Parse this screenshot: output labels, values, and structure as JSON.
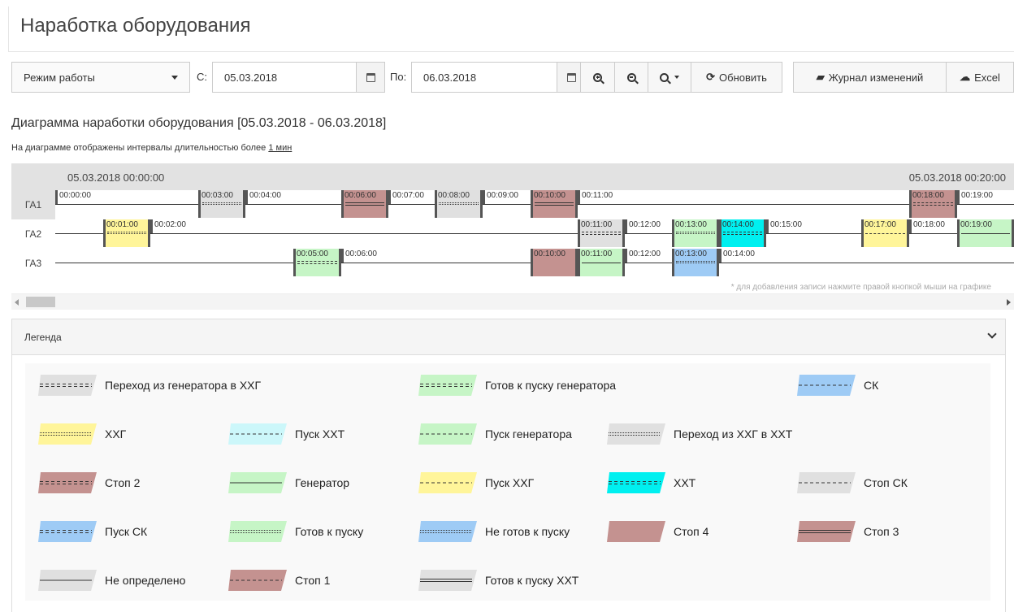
{
  "page": {
    "title": "Наработка оборудования"
  },
  "toolbar": {
    "mode_label": "Режим работы",
    "from_label": "С:",
    "from_value": "05.03.2018",
    "to_label": "По:",
    "to_value": "06.03.2018",
    "refresh_label": "Обновить",
    "journal_label": "Журнал изменений",
    "excel_label": "Excel"
  },
  "chart": {
    "title": "Диаграмма наработки оборудования [05.03.2018 - 06.03.2018]",
    "note_prefix": "На диаграмме отображены интервалы длительностью более ",
    "note_link": "1 мин",
    "header_left": "05.03.2018 00:00:00",
    "header_right": "05.03.2018 00:20:00",
    "hint": "* для добавления записи нажмите правой кнопкой мыши на графике",
    "rows": [
      {
        "label": "ГА1",
        "ticks": [
          {
            "t": "00:00:00"
          },
          {
            "t": "00:03:00"
          },
          {
            "t": "00:04:00"
          },
          {
            "t": "00:06:00"
          },
          {
            "t": "00:07:00"
          },
          {
            "t": "00:08:00"
          },
          {
            "t": "00:09:00"
          },
          {
            "t": "00:10:00"
          },
          {
            "t": "00:11:00"
          },
          {
            "t": "00:18:00"
          },
          {
            "t": "00:19:00"
          }
        ]
      },
      {
        "label": "ГА2",
        "ticks": [
          {
            "t": "00:01:00"
          },
          {
            "t": "00:02:00"
          },
          {
            "t": "00:11:00"
          },
          {
            "t": "00:12:00"
          },
          {
            "t": "00:13:00"
          },
          {
            "t": "00:14:00"
          },
          {
            "t": "00:15:00"
          },
          {
            "t": "00:17:00"
          },
          {
            "t": "00:18:00"
          },
          {
            "t": "00:19:00"
          }
        ]
      },
      {
        "label": "ГА3",
        "ticks": [
          {
            "t": "00:05:00"
          },
          {
            "t": "00:06:00"
          },
          {
            "t": "00:10:00"
          },
          {
            "t": "00:11:00"
          },
          {
            "t": "00:12:00"
          },
          {
            "t": "00:13:00"
          },
          {
            "t": "00:14:00"
          }
        ]
      }
    ]
  },
  "legend": {
    "title": "Легенда",
    "items": [
      {
        "label": "Переход из генератора в ХХГ",
        "fill": "#e0e0e0",
        "line": "dash-double"
      },
      {
        "label": "Готов к пуску генератора",
        "fill": "#c6f5c6",
        "line": "dash-double"
      },
      {
        "label": "СК",
        "fill": "#9ecbf5",
        "line": "dash"
      },
      {
        "label": "ХХГ",
        "fill": "#fff59a",
        "line": "dotted"
      },
      {
        "label": "Пуск ХХТ",
        "fill": "#ccf7fa",
        "line": "dash"
      },
      {
        "label": "Пуск генератора",
        "fill": "#c6f5c6",
        "line": "dash"
      },
      {
        "label": "Переход из ХХГ в ХХТ",
        "fill": "#e0e0e0",
        "line": "dotted"
      },
      {
        "label": "Стоп 2",
        "fill": "#c49290",
        "line": "dash-double"
      },
      {
        "label": "Генератор",
        "fill": "#c6f5c6",
        "line": "solid"
      },
      {
        "label": "Пуск ХХГ",
        "fill": "#fff59a",
        "line": "dash"
      },
      {
        "label": "ХХТ",
        "fill": "#00f0f0",
        "line": "dash-double"
      },
      {
        "label": "Стоп СК",
        "fill": "#e0e0e0",
        "line": "dash"
      },
      {
        "label": "Пуск СК",
        "fill": "#9ecbf5",
        "line": "dash-double"
      },
      {
        "label": "Готов к пуску",
        "fill": "#c6f5c6",
        "line": "dotted"
      },
      {
        "label": "Не готов к пуску",
        "fill": "#9ecbf5",
        "line": "dotted"
      },
      {
        "label": "Стоп 4",
        "fill": "#c49290",
        "line": "none"
      },
      {
        "label": "Стоп 3",
        "fill": "#c49290",
        "line": "double"
      },
      {
        "label": "Не определено",
        "fill": "#e0e0e0",
        "line": "solid"
      },
      {
        "label": "Стоп 1",
        "fill": "#c49290",
        "line": "dash"
      },
      {
        "label": "Готов к пуску ХХТ",
        "fill": "#e0e0e0",
        "line": "double"
      }
    ]
  }
}
